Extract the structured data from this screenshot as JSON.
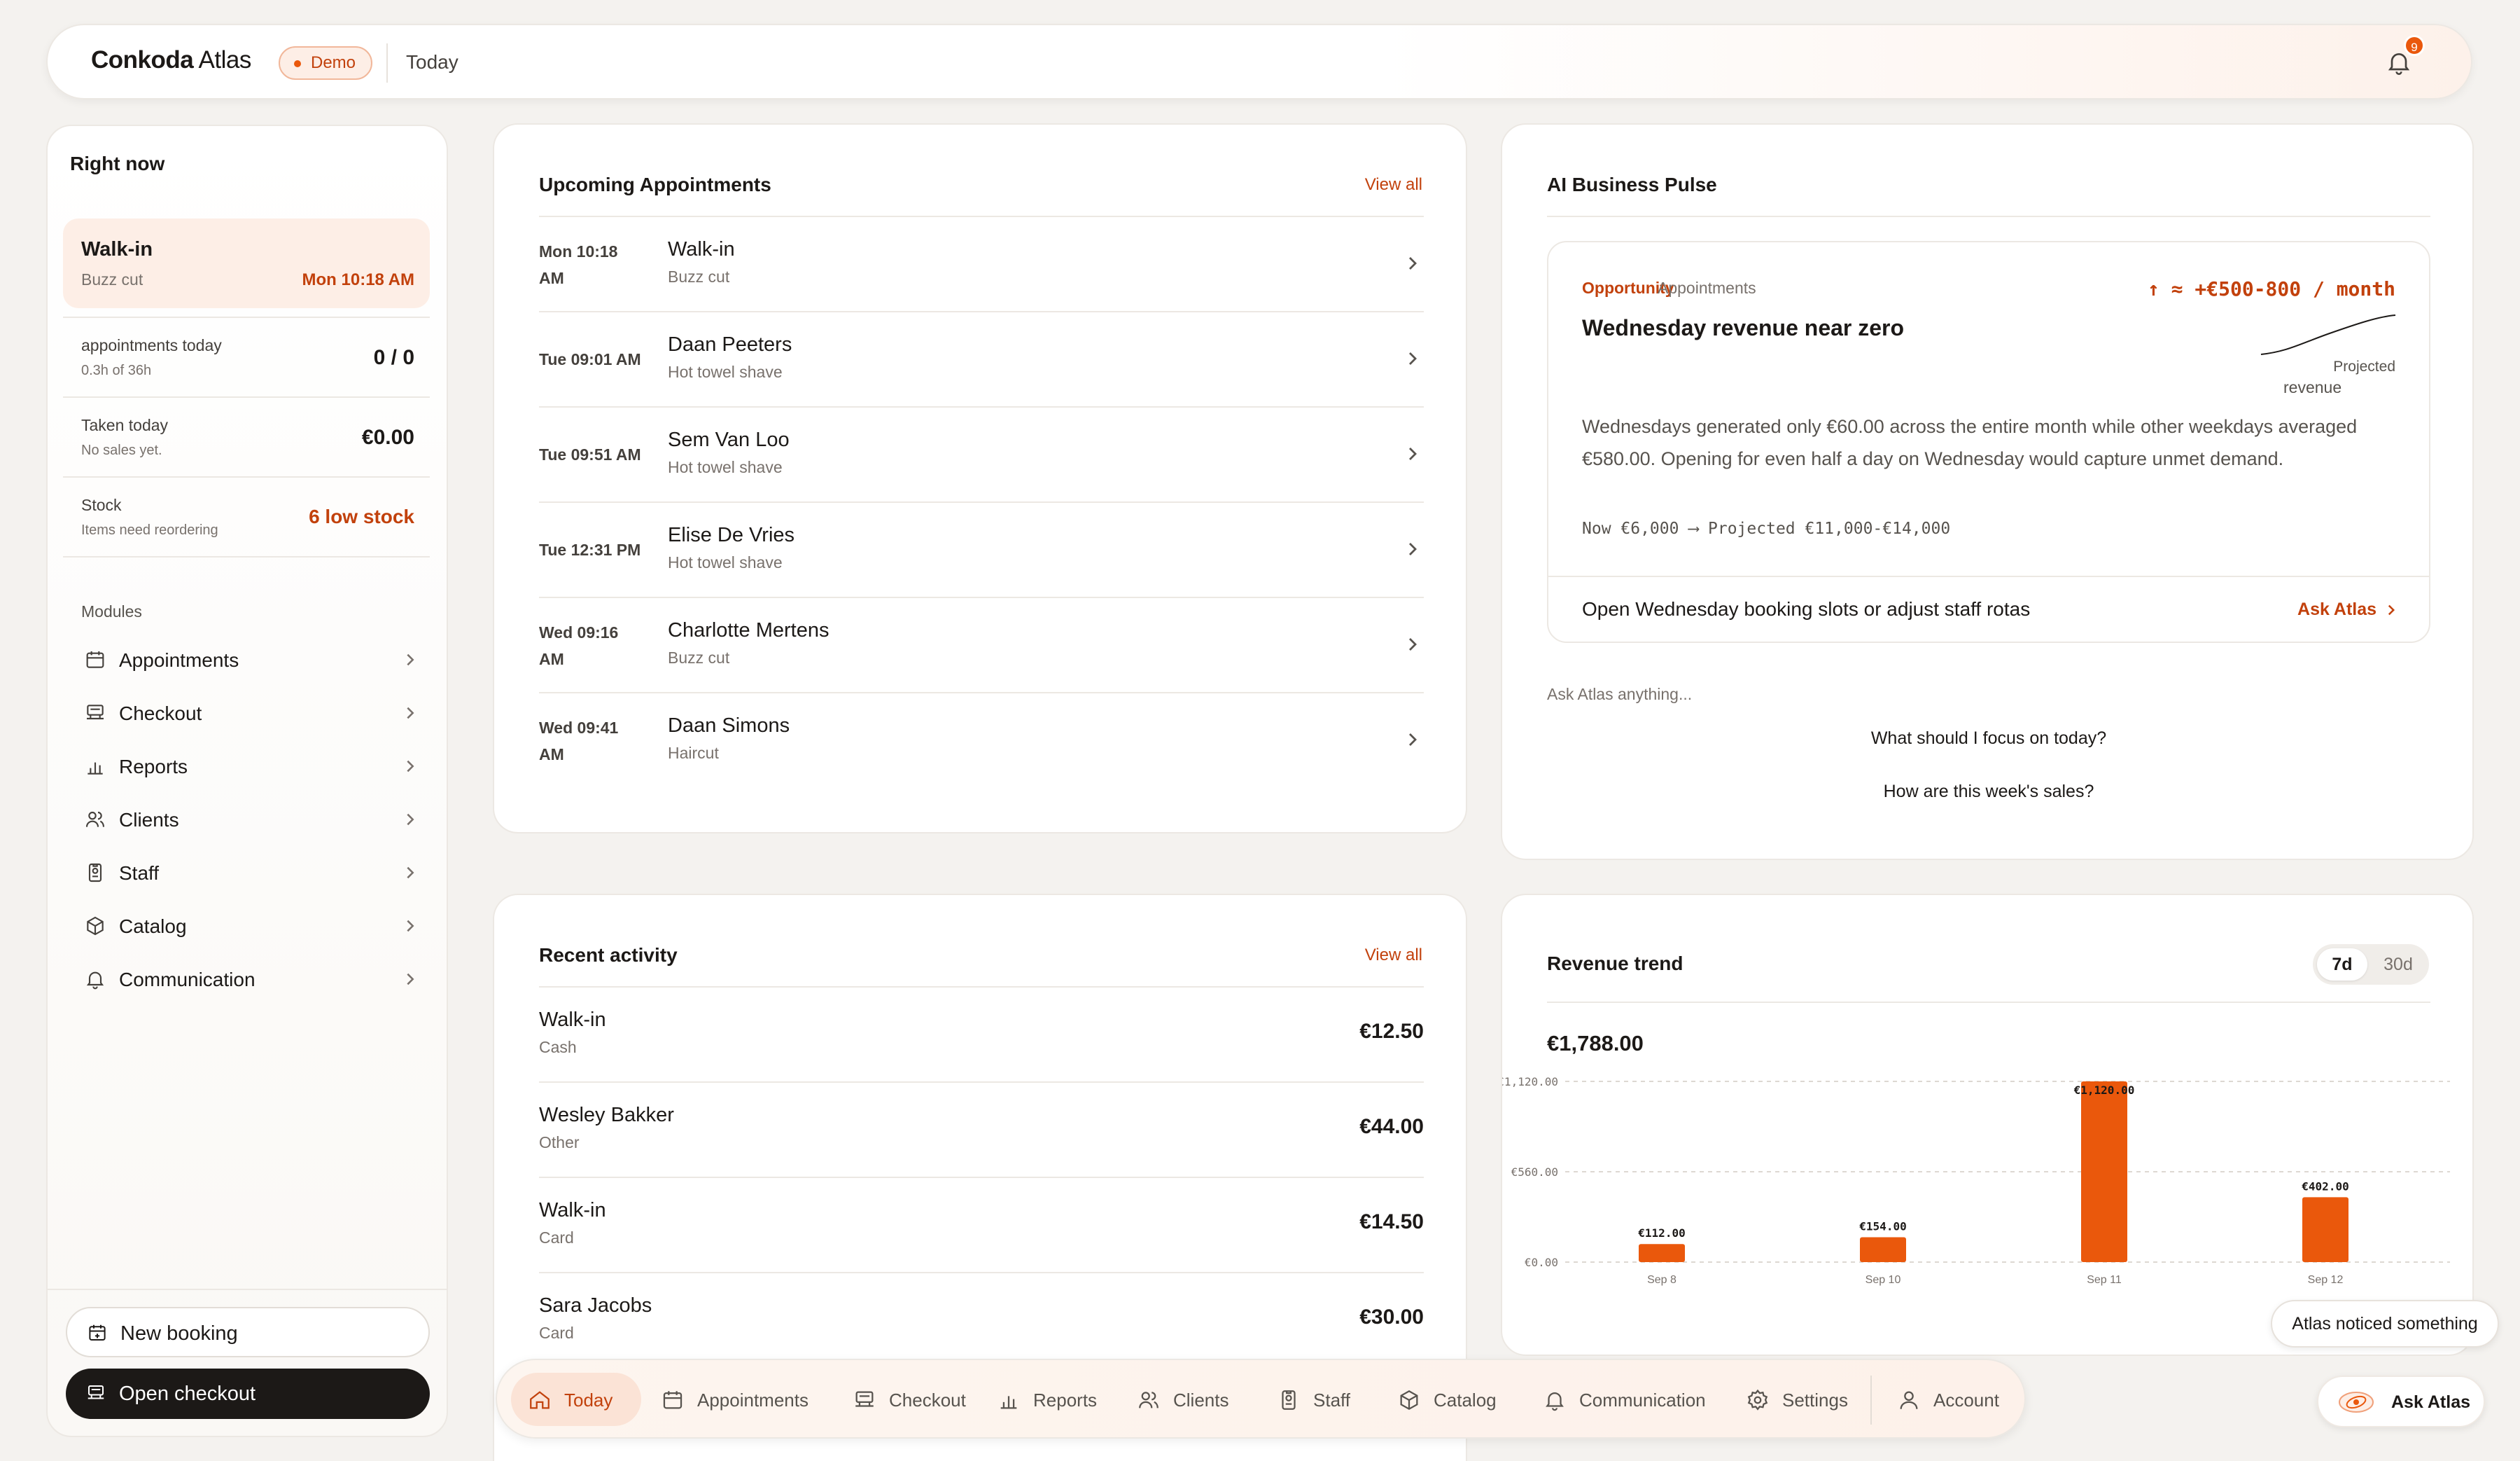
{
  "header": {
    "brand_bold": "Conkoda",
    "brand_rest": "Atlas",
    "badge": "Demo",
    "page": "Today",
    "notif_count": "9"
  },
  "left": {
    "title": "Right now",
    "current": {
      "name": "Walk-in",
      "service": "Buzz cut",
      "time": "Mon 10:18 AM"
    },
    "kpis": [
      {
        "label": "appointments today",
        "sub": "0.3h of 36h",
        "value": "0 / 0"
      },
      {
        "label": "Taken today",
        "sub": "No sales yet.",
        "value": "€0.00"
      },
      {
        "label": "Stock",
        "sub": "Items need reordering",
        "value": "6 low stock"
      }
    ],
    "modules_title": "Modules",
    "modules": [
      {
        "label": "Appointments",
        "icon": "calendar-icon"
      },
      {
        "label": "Checkout",
        "icon": "register-icon"
      },
      {
        "label": "Reports",
        "icon": "bar-chart-icon"
      },
      {
        "label": "Clients",
        "icon": "users-icon"
      },
      {
        "label": "Staff",
        "icon": "badge-icon"
      },
      {
        "label": "Catalog",
        "icon": "box-icon"
      },
      {
        "label": "Communication",
        "icon": "bell-icon"
      }
    ],
    "new_booking": "New booking",
    "open_checkout": "Open checkout"
  },
  "appointments": {
    "title": "Upcoming Appointments",
    "view_all": "View all",
    "items": [
      {
        "time1": "Mon 10:18",
        "time2": "AM",
        "name": "Walk-in",
        "service": "Buzz cut"
      },
      {
        "time1": "Tue 09:01 AM",
        "time2": "",
        "name": "Daan Peeters",
        "service": "Hot towel shave"
      },
      {
        "time1": "Tue 09:51 AM",
        "time2": "",
        "name": "Sem Van Loo",
        "service": "Hot towel shave"
      },
      {
        "time1": "Tue 12:31 PM",
        "time2": "",
        "name": "Elise De Vries",
        "service": "Hot towel shave"
      },
      {
        "time1": "Wed 09:16",
        "time2": "AM",
        "name": "Charlotte Mertens",
        "service": "Buzz cut"
      },
      {
        "time1": "Wed 09:41",
        "time2": "AM",
        "name": "Daan Simons",
        "service": "Haircut"
      }
    ]
  },
  "activity": {
    "title": "Recent activity",
    "view_all": "View all",
    "items": [
      {
        "name": "Walk-in",
        "method": "Cash",
        "amount": "€12.50"
      },
      {
        "name": "Wesley Bakker",
        "method": "Other",
        "amount": "€44.00"
      },
      {
        "name": "Walk-in",
        "method": "Card",
        "amount": "€14.50"
      },
      {
        "name": "Sara Jacobs",
        "method": "Card",
        "amount": "€30.00"
      }
    ]
  },
  "pulse": {
    "title": "AI Business Pulse",
    "tag": "Opportunity",
    "category": "Appointments",
    "impact": "↑ ≈ +€500-800 / month",
    "headline": "Wednesday revenue near zero",
    "projected_1": "Projected",
    "projected_2": "revenue",
    "body": "Wednesdays generated only €60.00 across the entire month while other weekdays averaged €580.00. Opening for even half a day on Wednesday would capture unmet demand.",
    "numbers": "Now €6,000 ⟶ Projected €11,000-€14,000",
    "action": "Open Wednesday booking slots or adjust staff rotas",
    "ask_link": "Ask Atlas",
    "ask_placeholder": "Ask Atlas anything...",
    "suggestions": [
      "What should I focus on today?",
      "How are this week's sales?"
    ]
  },
  "revenue": {
    "title": "Revenue trend",
    "range_options": [
      "7d",
      "30d"
    ],
    "range_selected": "7d",
    "total": "€1,788.00"
  },
  "chart_data": {
    "type": "bar",
    "categories": [
      "Sep 8",
      "Sep 10",
      "Sep 11",
      "Sep 12"
    ],
    "values": [
      112,
      154,
      1120,
      402
    ],
    "value_labels": [
      "€112.00",
      "€154.00",
      "€1,120.00",
      "€402.00"
    ],
    "ylim": [
      0,
      1120
    ],
    "yticks": [
      0,
      560,
      1120
    ],
    "ytick_labels": [
      "€0.00",
      "€560.00",
      "€1,120.00"
    ],
    "grid": true,
    "bar_color": "#ea580c"
  },
  "nav": {
    "items": [
      {
        "label": "Today",
        "icon": "home-icon",
        "active": true
      },
      {
        "label": "Appointments",
        "icon": "calendar-icon"
      },
      {
        "label": "Checkout",
        "icon": "register-icon"
      },
      {
        "label": "Reports",
        "icon": "bar-chart-icon"
      },
      {
        "label": "Clients",
        "icon": "users-icon"
      },
      {
        "label": "Staff",
        "icon": "badge-icon"
      },
      {
        "label": "Catalog",
        "icon": "box-icon"
      },
      {
        "label": "Communication",
        "icon": "bell-icon"
      },
      {
        "label": "Settings",
        "icon": "gear-icon"
      },
      {
        "label": "Account",
        "icon": "user-icon"
      }
    ]
  },
  "atlas": {
    "noticed": "Atlas noticed something",
    "ask": "Ask Atlas"
  },
  "colors": {
    "accent": "#ea580c",
    "accent_text": "#c2410c",
    "dark": "#1c1917"
  }
}
